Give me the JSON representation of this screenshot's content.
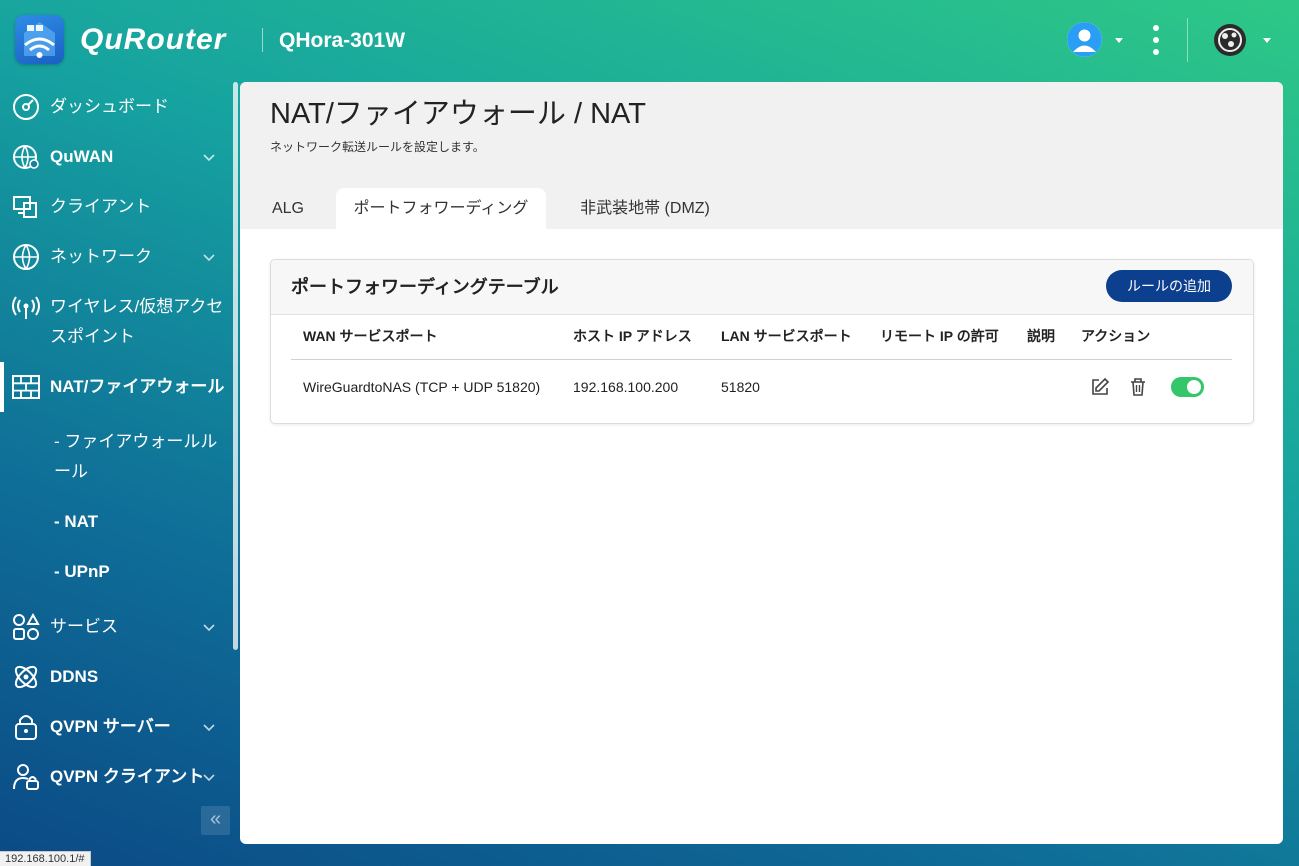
{
  "header": {
    "brand": "QuRouter",
    "device_name": "QHora-301W"
  },
  "sidebar": {
    "items": [
      {
        "label": "ダッシュボード"
      },
      {
        "label": "QuWAN"
      },
      {
        "label": "クライアント"
      },
      {
        "label": "ネットワーク"
      },
      {
        "label_line1": "ワイヤレス/仮想アクセ",
        "label_line2": "スポイント"
      },
      {
        "label": "NAT/ファイアウォール"
      },
      {
        "label": "サービス"
      },
      {
        "label": "DDNS"
      },
      {
        "label": "QVPN サーバー"
      },
      {
        "label": "QVPN クライアント"
      }
    ],
    "sub_items": [
      {
        "label_line1": "- ファイアウォールル",
        "label_line2": "ール"
      },
      {
        "label": "- NAT"
      },
      {
        "label": "- UPnP"
      }
    ],
    "collapse_symbol": "«"
  },
  "status_url": "192.168.100.1/#",
  "main": {
    "title": "NAT/ファイアウォール / NAT",
    "description": "ネットワーク転送ルールを設定します。",
    "tabs": [
      {
        "label": "ALG"
      },
      {
        "label": "ポートフォワーディング",
        "active": true
      },
      {
        "label": "非武装地帯 (DMZ)"
      }
    ],
    "card": {
      "title": "ポートフォワーディングテーブル",
      "add_button": "ルールの追加",
      "columns": [
        "WAN サービスポート",
        "ホスト IP アドレス",
        "LAN サービスポート",
        "リモート IP の許可",
        "説明",
        "アクション"
      ],
      "rows": [
        {
          "wan_port": "WireGuardtoNAS (TCP + UDP 51820)",
          "host_ip": "192.168.100.200",
          "lan_port": "51820",
          "remote_ip": "",
          "description": "",
          "enabled": true
        }
      ]
    }
  },
  "colors": {
    "accent_button": "#0d3f8f",
    "toggle_on": "#34c66b"
  },
  "icons": {
    "edit": "edit-icon",
    "delete": "trash-icon"
  }
}
